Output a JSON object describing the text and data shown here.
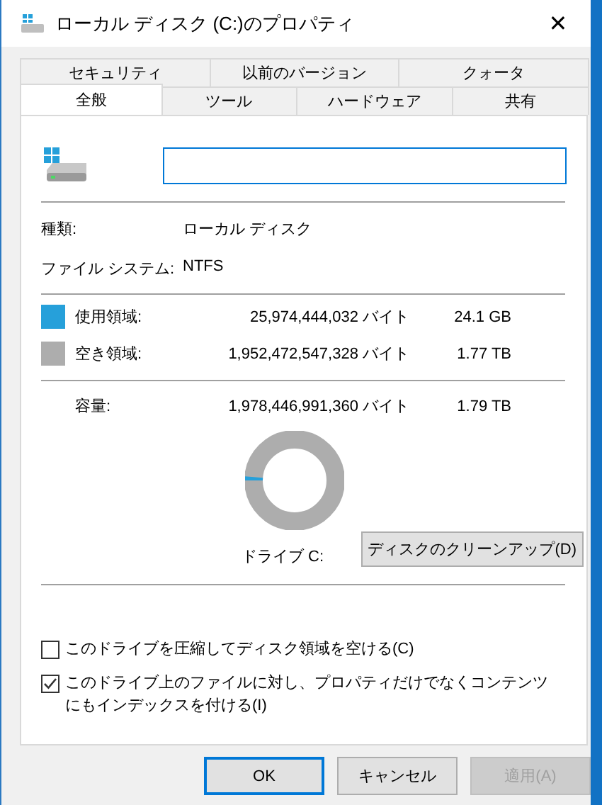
{
  "window": {
    "title": "ローカル ディスク (C:)のプロパティ",
    "close": "✕"
  },
  "tabs": [
    [
      {
        "label": "セキュリティ",
        "selected": false
      },
      {
        "label": "以前のバージョン",
        "selected": false
      },
      {
        "label": "クォータ",
        "selected": false
      }
    ],
    [
      {
        "label": "全般",
        "selected": true
      },
      {
        "label": "ツール",
        "selected": false
      },
      {
        "label": "ハードウェア",
        "selected": false
      },
      {
        "label": "共有",
        "selected": false
      }
    ]
  ],
  "general": {
    "info": [
      {
        "label": "種類:",
        "value": "ローカル ディスク"
      },
      {
        "label": "ファイル システム:",
        "value": "NTFS"
      }
    ],
    "space": [
      {
        "label": "使用領域:",
        "bytes": "25,974,444,032 バイト",
        "size": "24.1 GB",
        "color": "#26a0da"
      },
      {
        "label": "空き領域:",
        "bytes": "1,952,472,547,328 バイト",
        "size": "1.77 TB",
        "color": "#adadad"
      }
    ],
    "capacity": {
      "label": "容量:",
      "bytes": "1,978,446,991,360 バイト",
      "size": "1.79 TB"
    },
    "usage_ring": {
      "level": 0.013
    },
    "drive_label": "ドライブ C:",
    "cleanup_button": "ディスクのクリーンアップ(D)",
    "options": [
      {
        "label": "このドライブを圧縮してディスク領域を空ける(C)",
        "checked": false
      },
      {
        "label": "このドライブ上のファイルに対し、プロパティだけでなくコンテンツにもインデックスを付ける(I)",
        "checked": true
      }
    ]
  },
  "buttons": [
    {
      "label": "OK",
      "default": true,
      "disabled": false
    },
    {
      "label": "キャンセル",
      "default": false,
      "disabled": false
    },
    {
      "label": "適用(A)",
      "default": false,
      "disabled": true
    }
  ]
}
